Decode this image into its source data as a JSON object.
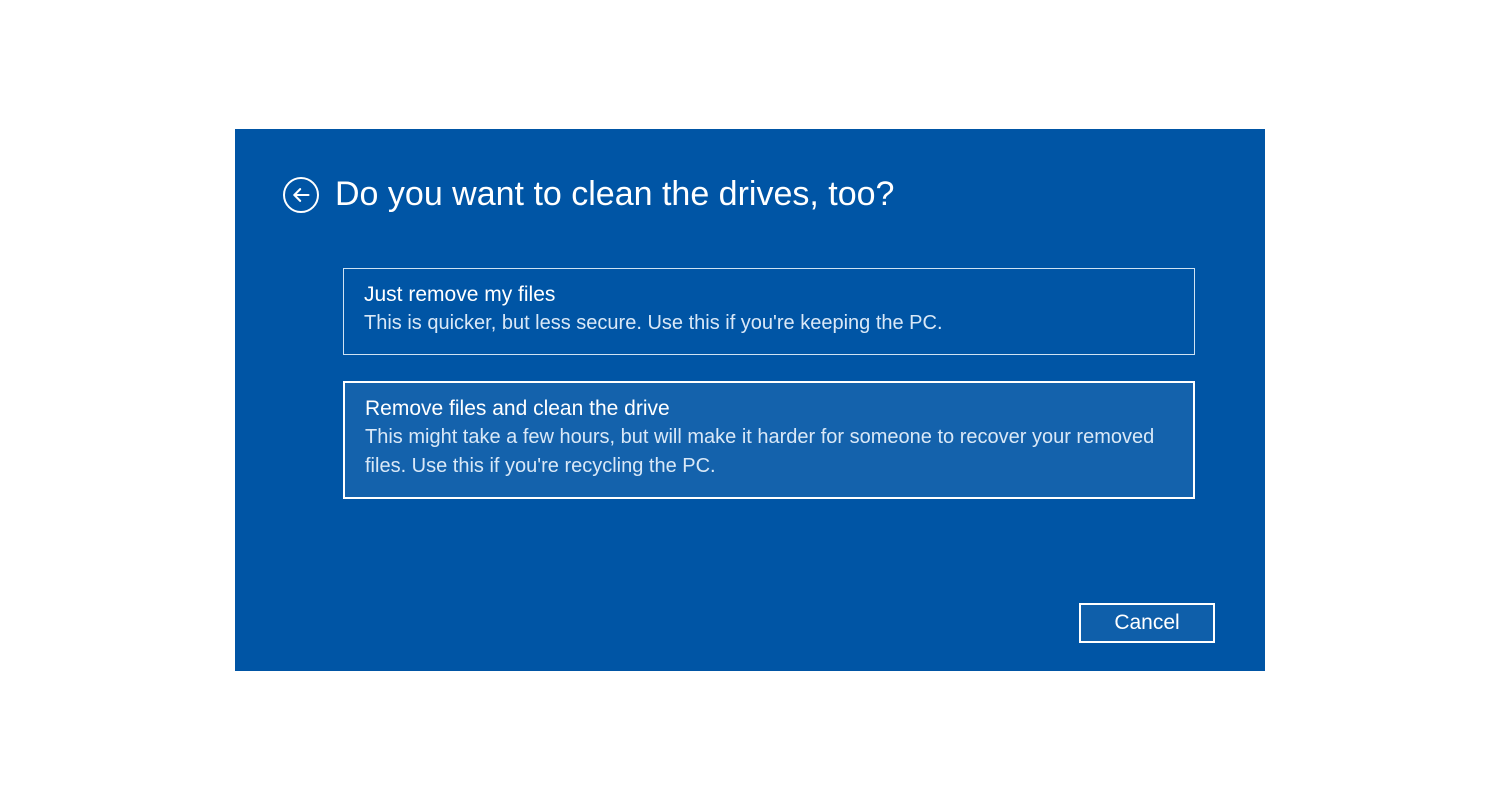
{
  "dialog": {
    "title": "Do you want to clean the drives, too?",
    "options": [
      {
        "title": "Just remove my files",
        "description": "This is quicker, but less secure. Use this if you're keeping the PC."
      },
      {
        "title": "Remove files and clean the drive",
        "description": "This might take a few hours, but will make it harder for someone to recover your removed files. Use this if you're recycling the PC."
      }
    ],
    "cancel_label": "Cancel"
  }
}
